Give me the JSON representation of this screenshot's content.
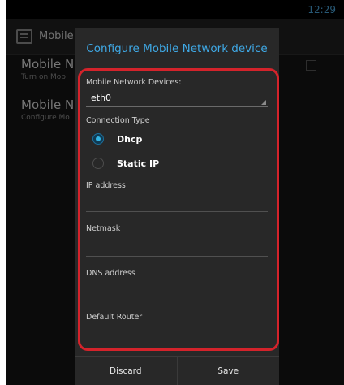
{
  "status_bar": {
    "time": "12:29"
  },
  "background_app": {
    "title": "Mobile N",
    "rows": [
      {
        "title": "Mobile Net",
        "summary": "Turn on Mob"
      },
      {
        "title": "Mobile Ne",
        "summary": "Configure Mo"
      }
    ]
  },
  "dialog": {
    "title": "Configure Mobile Network device",
    "devices_label": "Mobile Network Devices:",
    "device_selected": "eth0",
    "connection_type_label": "Connection Type",
    "options": [
      {
        "label": "Dhcp",
        "checked": true
      },
      {
        "label": "Static IP",
        "checked": false
      }
    ],
    "fields": {
      "ip_address": "IP address",
      "netmask": "Netmask",
      "dns_address": "DNS address",
      "default_router": "Default Router"
    },
    "buttons": {
      "discard": "Discard",
      "save": "Save"
    }
  },
  "colors": {
    "accent": "#33b5e5",
    "title": "#3fa9e6",
    "highlight": "#d4232b"
  }
}
